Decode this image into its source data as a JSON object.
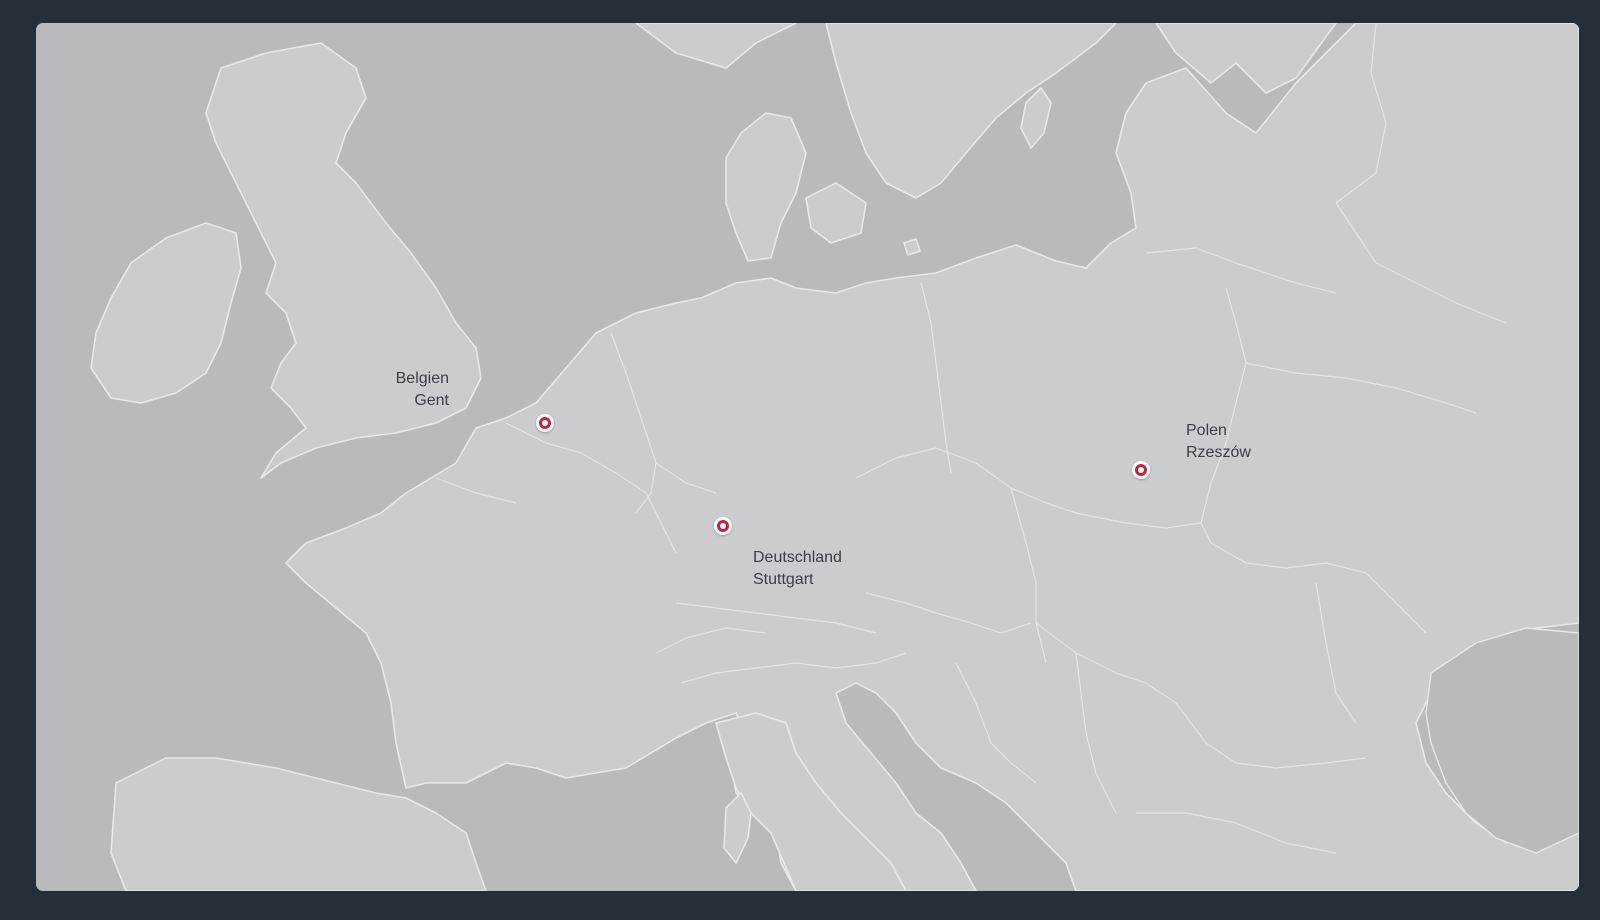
{
  "map": {
    "colors": {
      "background": "#262e3a",
      "water": "#b8babe",
      "land": "#cbccce",
      "borders": "#e6e7e9",
      "marker": "#c0263a",
      "label_text": "#3a3f47"
    },
    "locations": [
      {
        "country": "Belgien",
        "city": "Gent",
        "marker_icon": "location-pin-icon"
      },
      {
        "country": "Deutschland",
        "city": "Stuttgart",
        "marker_icon": "location-pin-icon"
      },
      {
        "country": "Polen",
        "city": "Rzeszów",
        "marker_icon": "location-pin-icon"
      }
    ]
  }
}
